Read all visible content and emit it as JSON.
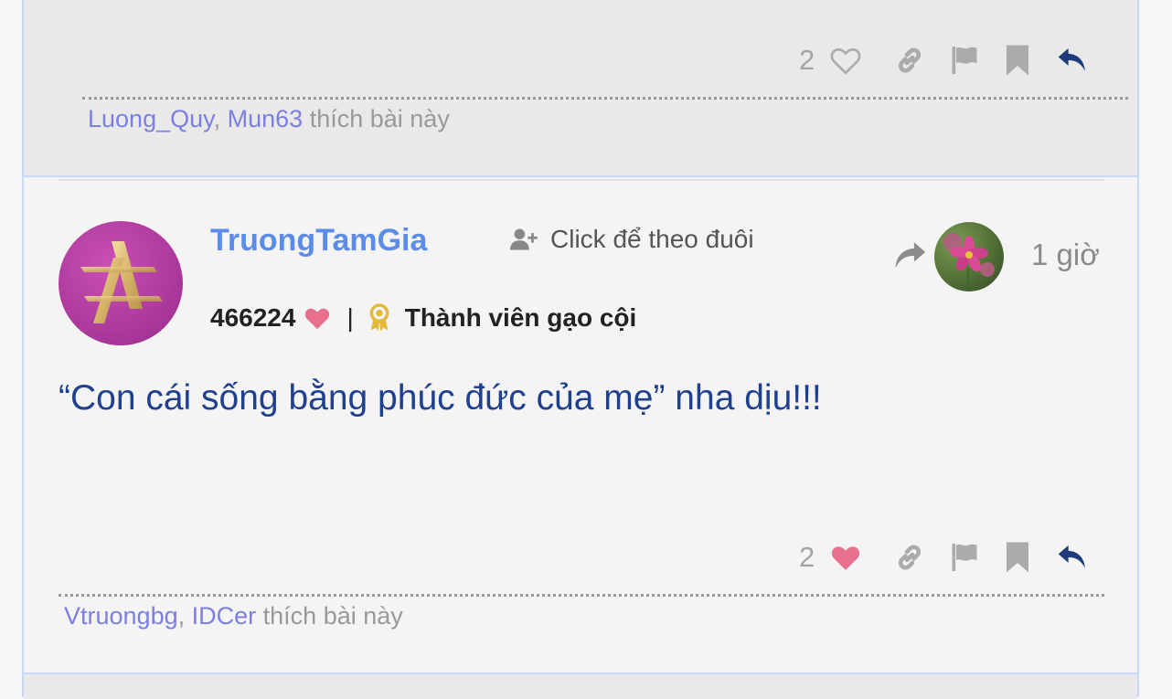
{
  "prev_post": {
    "like_count": "2",
    "liked": false,
    "likers": [
      "Luong_Quy",
      "Mun63"
    ],
    "likers_suffix": "thích bài này"
  },
  "post": {
    "username": "TruongTamGia",
    "follow_label": "Click để theo đuôi",
    "points": "466224",
    "separator": "|",
    "rank": "Thành viên gạo cội",
    "time": "1 giờ",
    "content": "“Con cái sống bằng phúc đức của mẹ” nha dịu!!!",
    "like_count": "2",
    "liked": true,
    "likers": [
      "Vtruongbg",
      "IDCer"
    ],
    "likers_suffix": "thích bài này"
  },
  "colors": {
    "heart": "#e8708c",
    "icon_gray": "#ababab",
    "reply": "#1f3b7a",
    "link": "#7d7fe0",
    "username": "#5b8de8",
    "content": "#1f3f8f"
  },
  "icons": [
    "heart-outline-icon",
    "link-icon",
    "flag-icon",
    "bookmark-icon",
    "reply-icon",
    "user-plus-icon",
    "share-icon",
    "medal-icon",
    "heart-icon"
  ]
}
